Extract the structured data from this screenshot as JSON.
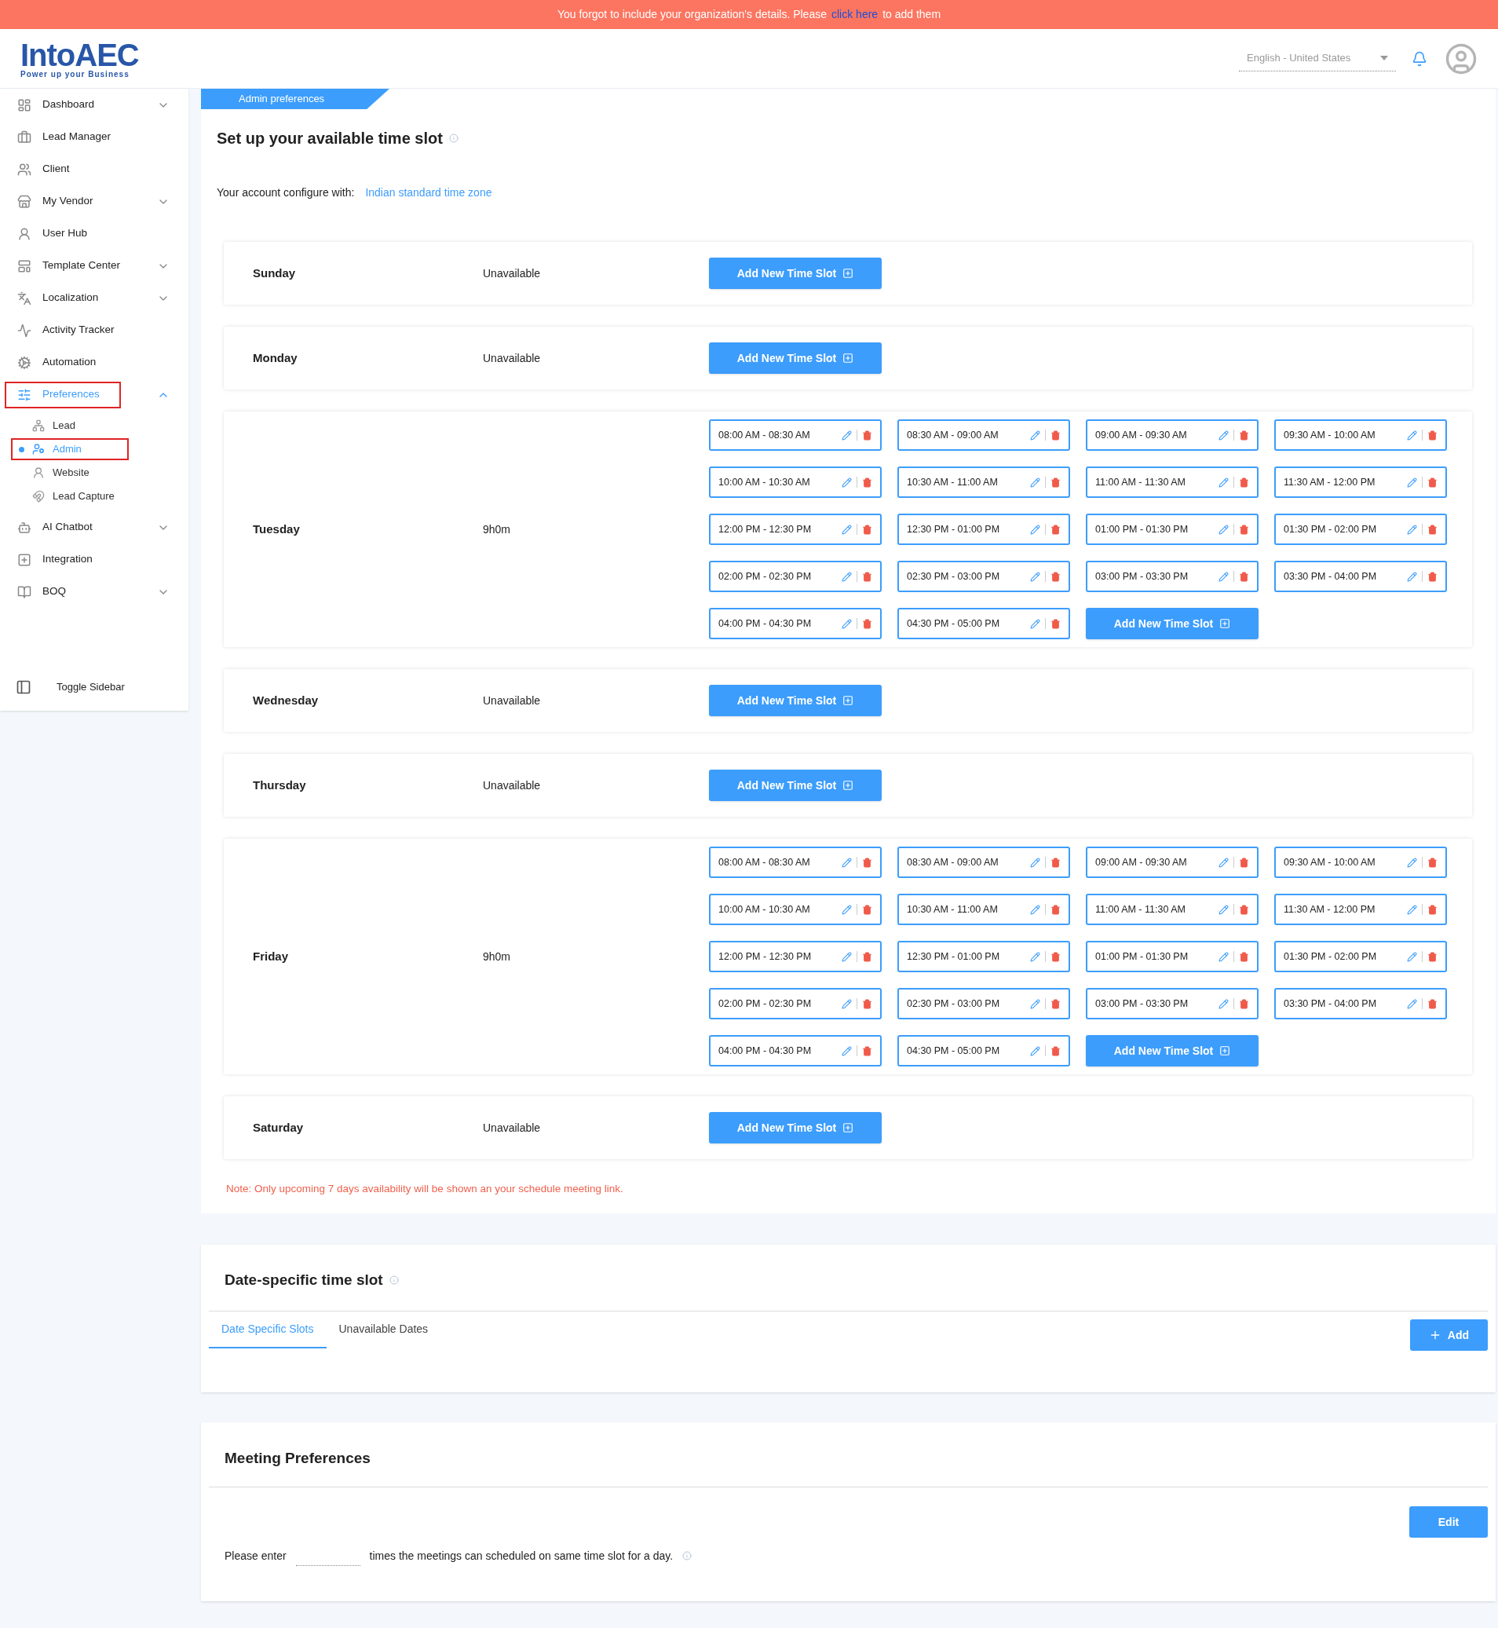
{
  "banner": {
    "text": "You forgot to include your organization's details. Please",
    "link": "click here",
    "after": "to add them"
  },
  "header": {
    "logo": "IntoAEC",
    "tagline": "Power up your Business",
    "language": "English - United States"
  },
  "sidebar": {
    "items": [
      {
        "label": "Dashboard",
        "expanded": false,
        "selected": false,
        "outlined": false
      },
      {
        "label": "Lead Manager",
        "selected": false,
        "outlined": false
      },
      {
        "label": "Client",
        "selected": false,
        "outlined": false
      },
      {
        "label": "My Vendor",
        "expanded": false,
        "selected": false,
        "outlined": false
      },
      {
        "label": "User Hub",
        "selected": false,
        "outlined": false
      },
      {
        "label": "Template Center",
        "expanded": false,
        "selected": false,
        "outlined": false
      },
      {
        "label": "Localization",
        "expanded": false,
        "selected": false,
        "outlined": false
      },
      {
        "label": "Activity Tracker",
        "selected": false,
        "outlined": false
      },
      {
        "label": "Automation",
        "selected": false,
        "outlined": false
      },
      {
        "label": "Preferences",
        "expanded": true,
        "selected": true,
        "outlined": true,
        "children": [
          {
            "label": "Lead",
            "selected": false,
            "outlined": false
          },
          {
            "label": "Admin",
            "selected": true,
            "outlined": true
          },
          {
            "label": "Website",
            "selected": false,
            "outlined": false
          },
          {
            "label": "Lead Capture",
            "selected": false,
            "outlined": false
          }
        ]
      },
      {
        "label": "AI Chatbot",
        "expanded": false,
        "selected": false,
        "outlined": false
      },
      {
        "label": "Integration",
        "selected": false,
        "outlined": false
      },
      {
        "label": "BOQ",
        "expanded": false,
        "selected": false,
        "outlined": false
      }
    ],
    "toggle": "Toggle Sidebar"
  },
  "page_tab": "Admin preferences",
  "availability": {
    "title": "Set up your available time slot",
    "timezone_label": "Your account configure with:",
    "timezone": "Indian standard time zone",
    "days": [
      {
        "name": "Sunday",
        "status": "Unavailable",
        "add": "Add New Time Slot"
      },
      {
        "name": "Monday",
        "status": "Unavailable",
        "add": "Add New Time Slot"
      },
      {
        "name": "Tuesday",
        "status": "9h0m",
        "slots": [
          "08:00 AM - 08:30 AM",
          "08:30 AM - 09:00 AM",
          "09:00 AM - 09:30 AM",
          "09:30 AM - 10:00 AM",
          "10:00 AM - 10:30 AM",
          "10:30 AM - 11:00 AM",
          "11:00 AM - 11:30 AM",
          "11:30 AM - 12:00 PM",
          "12:00 PM - 12:30 PM",
          "12:30 PM - 01:00 PM",
          "01:00 PM - 01:30 PM",
          "01:30 PM - 02:00 PM",
          "02:00 PM - 02:30 PM",
          "02:30 PM - 03:00 PM",
          "03:00 PM - 03:30 PM",
          "03:30 PM - 04:00 PM",
          "04:00 PM - 04:30 PM",
          "04:30 PM - 05:00 PM"
        ],
        "add": "Add New Time Slot"
      },
      {
        "name": "Wednesday",
        "status": "Unavailable",
        "add": "Add New Time Slot"
      },
      {
        "name": "Thursday",
        "status": "Unavailable",
        "add": "Add New Time Slot"
      },
      {
        "name": "Friday",
        "status": "9h0m",
        "slots": [
          "08:00 AM - 08:30 AM",
          "08:30 AM - 09:00 AM",
          "09:00 AM - 09:30 AM",
          "09:30 AM - 10:00 AM",
          "10:00 AM - 10:30 AM",
          "10:30 AM - 11:00 AM",
          "11:00 AM - 11:30 AM",
          "11:30 AM - 12:00 PM",
          "12:00 PM - 12:30 PM",
          "12:30 PM - 01:00 PM",
          "01:00 PM - 01:30 PM",
          "01:30 PM - 02:00 PM",
          "02:00 PM - 02:30 PM",
          "02:30 PM - 03:00 PM",
          "03:00 PM - 03:30 PM",
          "03:30 PM - 04:00 PM",
          "04:00 PM - 04:30 PM",
          "04:30 PM - 05:00 PM"
        ],
        "add": "Add New Time Slot"
      },
      {
        "name": "Saturday",
        "status": "Unavailable",
        "add": "Add New Time Slot"
      }
    ],
    "note": "Note: Only upcoming 7 days availability will be shown an your schedule meeting link."
  },
  "date_specific": {
    "title": "Date-specific time slot",
    "tabs": [
      {
        "label": "Date Specific Slots",
        "selected": true
      },
      {
        "label": "Unavailable Dates",
        "selected": false
      }
    ],
    "add": "Add"
  },
  "meeting": {
    "title": "Meeting Preferences",
    "edit": "Edit",
    "before": "Please enter",
    "after": "times the meetings can scheduled on same time slot for a day."
  }
}
